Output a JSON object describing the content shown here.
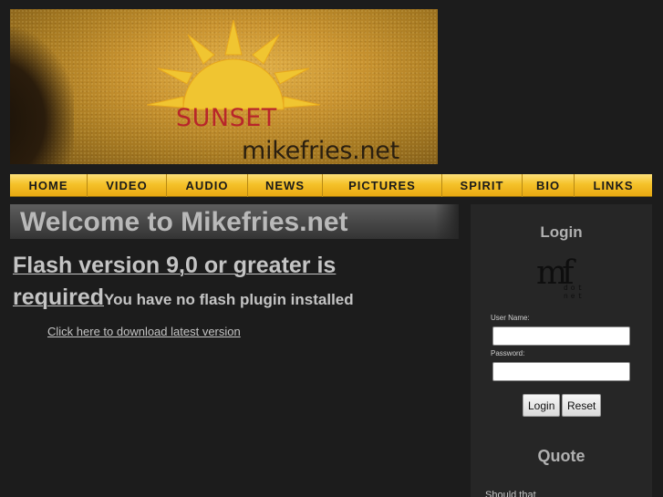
{
  "banner": {
    "sunset_text": "SUNSET",
    "site_text": "mikefries.net",
    "colors": {
      "sand": "#c99330",
      "sun": "#f0c531",
      "sunset_text": "#b8262a"
    }
  },
  "nav": {
    "items": [
      {
        "label": "HOME"
      },
      {
        "label": "VIDEO"
      },
      {
        "label": "AUDIO"
      },
      {
        "label": "NEWS"
      },
      {
        "label": "PICTURES"
      },
      {
        "label": "SPIRIT"
      },
      {
        "label": "BIO"
      },
      {
        "label": "LINKS"
      }
    ]
  },
  "main": {
    "welcome_title": "Welcome to Mikefries.net",
    "flash_required": "Flash version 9,0 or greater is required",
    "flash_missing": "You have no flash plugin installed",
    "download_link": "Click here to download latest version"
  },
  "sidebar": {
    "login_title": "Login",
    "logo": {
      "mf": "mf",
      "dot": "dot",
      "net": "net"
    },
    "username_label": "User Name:",
    "username_value": "",
    "password_label": "Password:",
    "password_value": "",
    "login_button": "Login",
    "reset_button": "Reset",
    "quote_title": "Quote",
    "quote_text": "Should that"
  }
}
